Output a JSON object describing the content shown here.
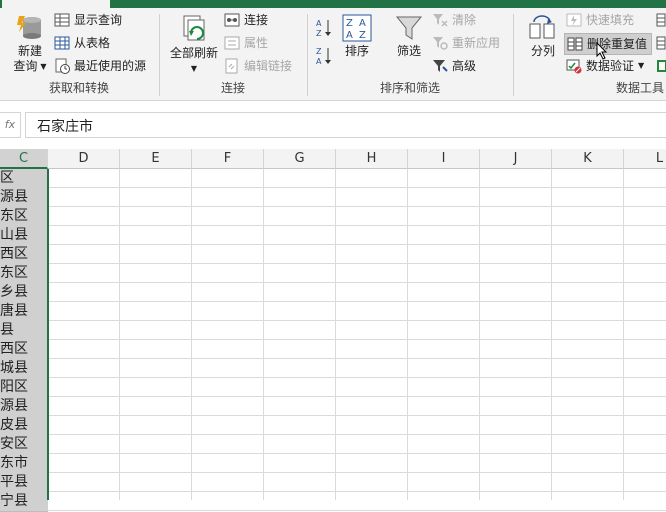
{
  "ribbon": {
    "get_transform": {
      "new_query_line1": "新建",
      "new_query_line2": "查询",
      "show_queries": "显示查询",
      "from_table": "从表格",
      "recent_sources": "最近使用的源",
      "group_label": "获取和转换"
    },
    "connections": {
      "refresh_all": "全部刷新",
      "connections": "连接",
      "properties": "属性",
      "edit_links": "编辑链接",
      "group_label": "连接"
    },
    "sort_filter": {
      "sort": "排序",
      "filter": "筛选",
      "clear": "清除",
      "reapply": "重新应用",
      "advanced": "高级",
      "group_label": "排序和筛选"
    },
    "data_tools": {
      "text_to_columns": "分列",
      "flash_fill": "快速填充",
      "remove_duplicates": "删除重复值",
      "data_validation": "数据验证",
      "group_label": "数据工具"
    }
  },
  "formula_bar": {
    "fx_label": "fx",
    "value": "石家庄市"
  },
  "sheet": {
    "selected_column": "C",
    "columns": [
      "C",
      "D",
      "E",
      "F",
      "G",
      "H",
      "I",
      "J",
      "K",
      "L"
    ],
    "column_c_cells": [
      "区",
      "源县",
      "东区",
      "山县",
      "西区",
      "东区",
      "乡县",
      "唐县",
      "县",
      "西区",
      "城县",
      "阳区",
      "源县",
      "皮县",
      "安区",
      "东市",
      "平县",
      "宁县"
    ]
  },
  "colors": {
    "excel_green": "#217346",
    "ribbon_bg": "#f3f3f3",
    "selected_cells": "#d0d0d0"
  }
}
